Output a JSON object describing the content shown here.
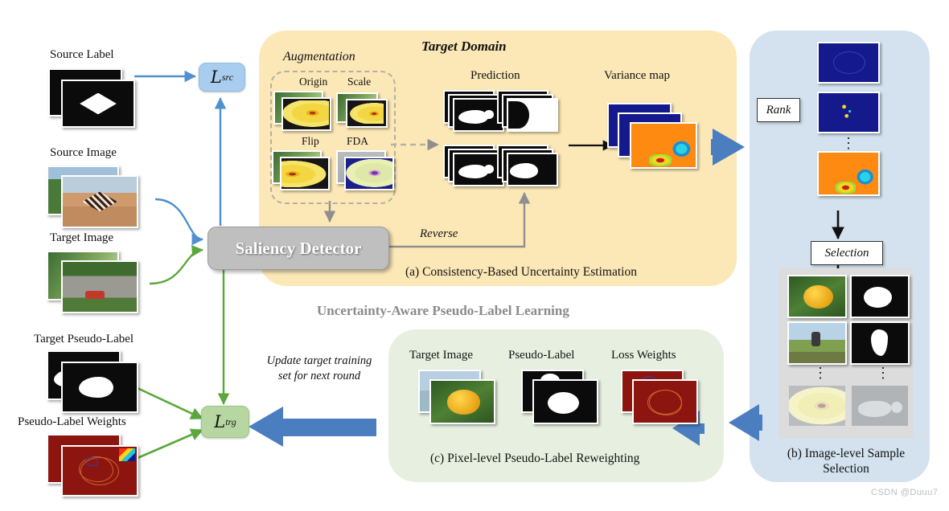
{
  "figure": {
    "banner": "Uncertainty-Aware Pseudo-Label Learning",
    "watermark": "CSDN @Duuu7"
  },
  "left_column": {
    "source_label": "Source Label",
    "source_image": "Source Image",
    "target_image": "Target Image",
    "target_pseudo_label": "Target Pseudo-Label",
    "pseudo_label_weights": "Pseudo-Label Weights"
  },
  "losses": {
    "src_symbol": "L",
    "src_sub": "src",
    "trg_symbol": "L",
    "trg_sub": "trg"
  },
  "detector": {
    "label": "Saliency Detector"
  },
  "panel_a": {
    "title": "Target Domain",
    "augmentation_label": "Augmentation",
    "augmentations": [
      "Origin",
      "Scale",
      "Flip",
      "FDA"
    ],
    "prediction_label": "Prediction",
    "variance_label": "Variance map",
    "reverse_label": "Reverse",
    "caption": "(a) Consistency-Based Uncertainty Estimation"
  },
  "panel_b": {
    "rank_label": "Rank",
    "selection_label": "Selection",
    "caption_line1": "(b) Image-level Sample",
    "caption_line2": "Selection",
    "vertical_ellipsis": "⋮"
  },
  "panel_c": {
    "col_headers": [
      "Target Image",
      "Pseudo-Label",
      "Loss Weights"
    ],
    "caption": "(c) Pixel-level Pseudo-Label Reweighting"
  },
  "feedback": {
    "line1": "Update target training",
    "line2": "set for next round"
  },
  "colors": {
    "panel_a_bg": "#fce8b7",
    "panel_b_bg": "#d3e2ee",
    "panel_c_bg": "#e7f0e0",
    "blue_arrow": "#4a7ec0",
    "blue_flow": "#4f90d0",
    "green_flow": "#5aa83c",
    "grey_flow": "#8f8f8f",
    "detector_bg": "#bfbfbf",
    "loss_src_bg": "#a9cdee",
    "loss_trg_bg": "#b6d7a1",
    "banner_text": "#8a8a8a"
  }
}
